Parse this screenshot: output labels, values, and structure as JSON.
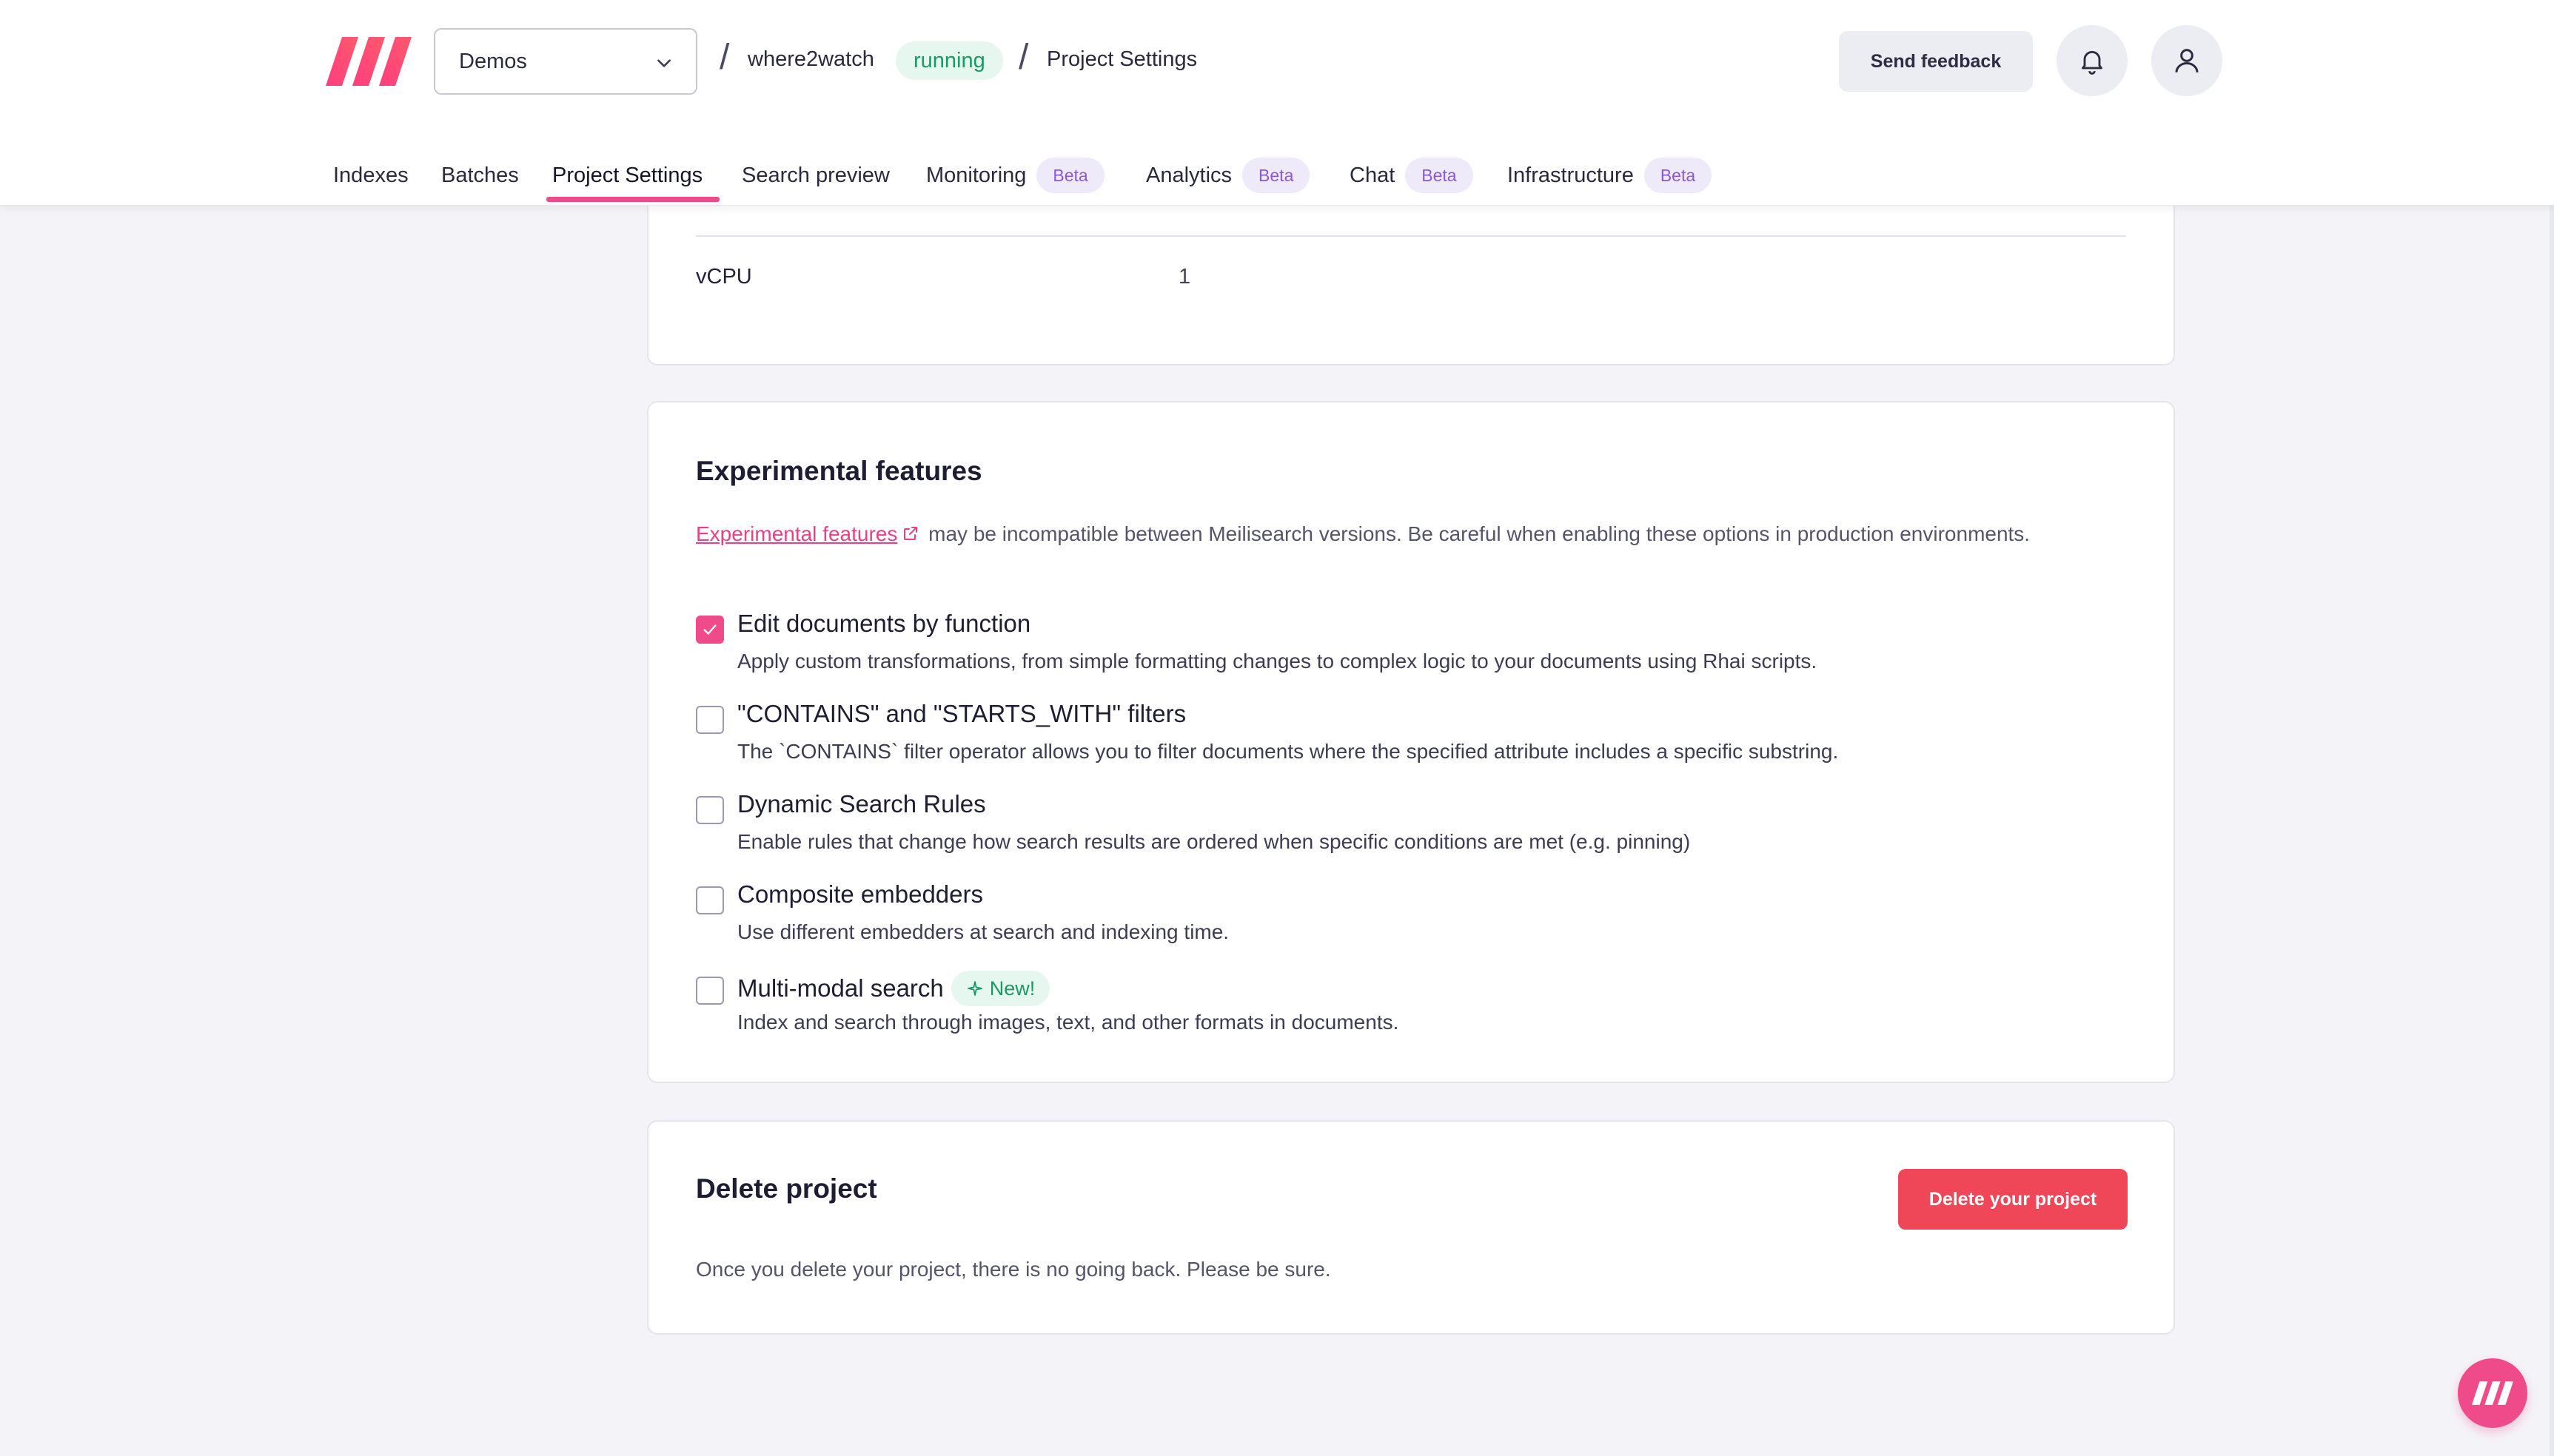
{
  "header": {
    "project_select": "Demos",
    "breadcrumb": {
      "project": "where2watch",
      "status": "running",
      "page": "Project Settings",
      "separator": "/"
    },
    "feedback_label": "Send feedback"
  },
  "tabs": [
    {
      "label": "Indexes"
    },
    {
      "label": "Batches"
    },
    {
      "label": "Project Settings"
    },
    {
      "label": "Search preview"
    },
    {
      "label": "Monitoring",
      "badge": "Beta"
    },
    {
      "label": "Analytics",
      "badge": "Beta"
    },
    {
      "label": "Chat",
      "badge": "Beta"
    },
    {
      "label": "Infrastructure",
      "badge": "Beta"
    }
  ],
  "resources": {
    "vcpu_label": "vCPU",
    "vcpu_value": "1"
  },
  "experimental": {
    "title": "Experimental features",
    "intro_link": "Experimental features",
    "intro_text": " may be incompatible between Meilisearch versions. Be careful when enabling these options in production environments.",
    "features": [
      {
        "title": "Edit documents by function",
        "desc": "Apply custom transformations, from simple formatting changes to complex logic to your documents using Rhai scripts.",
        "checked": true
      },
      {
        "title": "\"CONTAINS\" and \"STARTS_WITH\" filters",
        "desc": "The `CONTAINS` filter operator allows you to filter documents where the specified attribute includes a specific substring.",
        "checked": false
      },
      {
        "title": "Dynamic Search Rules",
        "desc": "Enable rules that change how search results are ordered when specific conditions are met (e.g. pinning)",
        "checked": false
      },
      {
        "title": "Composite embedders",
        "desc": "Use different embedders at search and indexing time.",
        "checked": false
      },
      {
        "title": "Multi-modal search",
        "desc": "Index and search through images, text, and other formats in documents.",
        "checked": false,
        "badge": "New!"
      }
    ]
  },
  "delete_project": {
    "title": "Delete project",
    "button_label": "Delete your project",
    "desc": "Once you delete your project, there is no going back. Please be sure."
  },
  "colors": {
    "accent": "#ef4b8a",
    "danger": "#ef4658",
    "success": "#1a9a64",
    "beta": "#8a5ad1"
  }
}
